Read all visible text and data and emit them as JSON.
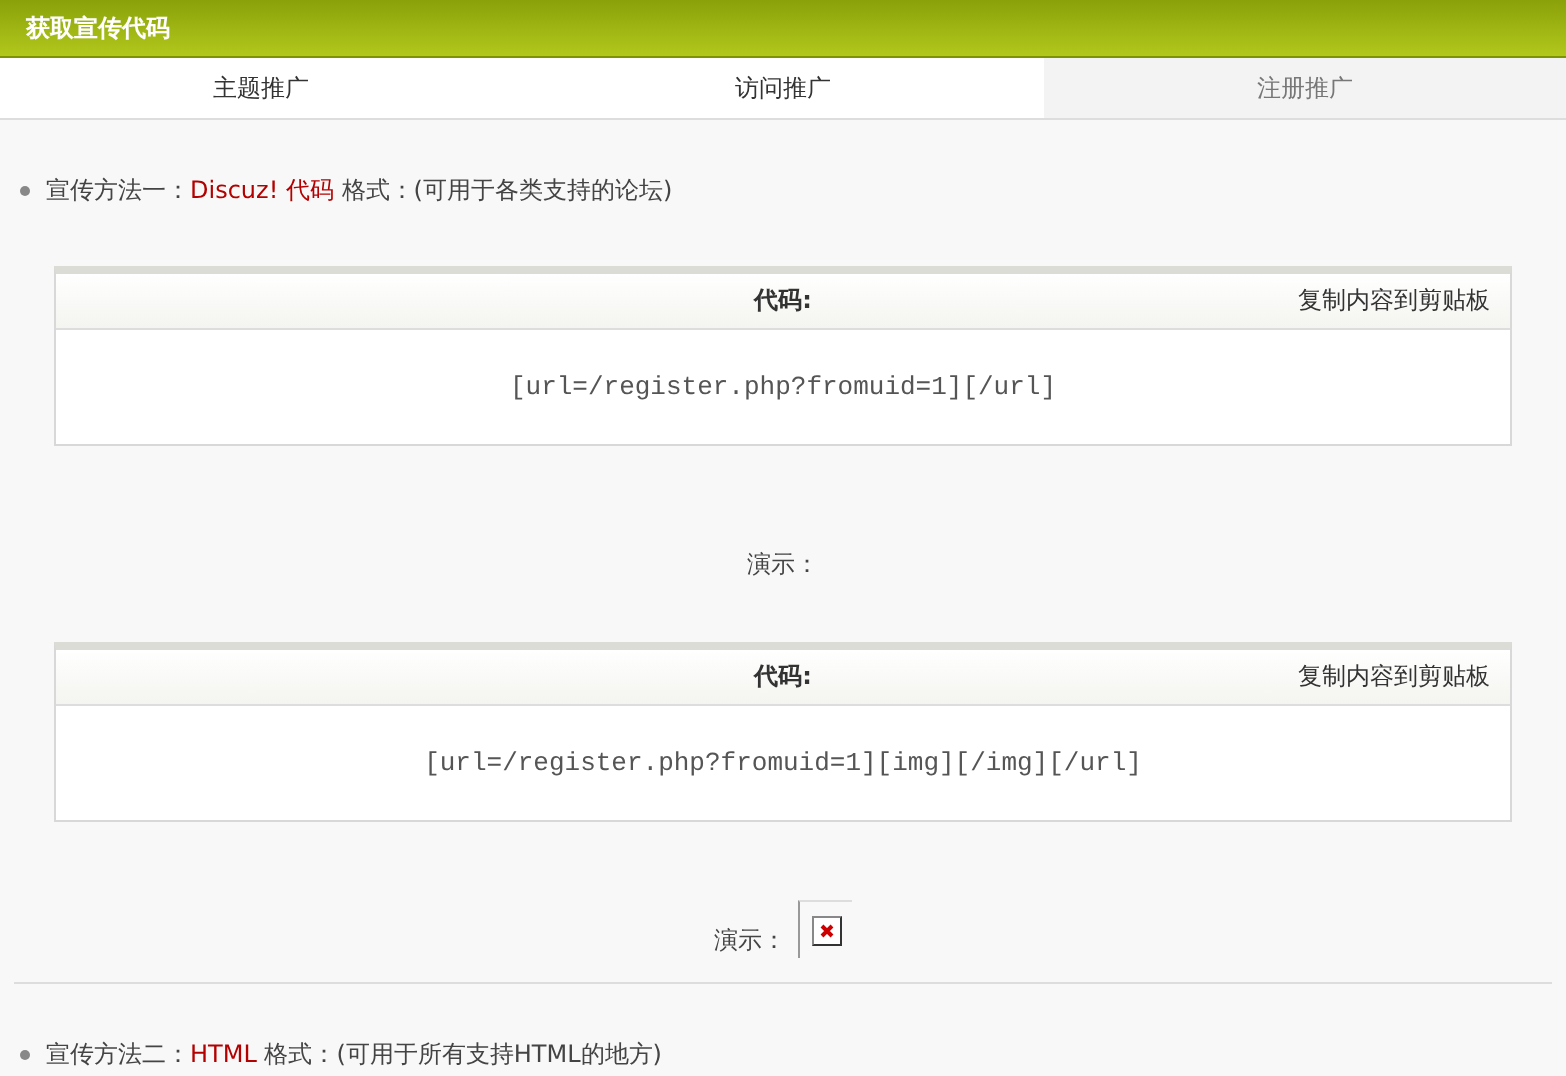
{
  "header": {
    "title": "获取宣传代码"
  },
  "tabs": [
    {
      "label": "主题推广",
      "selected": false
    },
    {
      "label": "访问推广",
      "selected": false
    },
    {
      "label": "注册推广",
      "selected": true
    }
  ],
  "methods": [
    {
      "prefix": "宣传方法一：",
      "highlight": "Discuz! 代码",
      "suffix": "格式：(可用于各类支持的论坛)",
      "blocks": [
        {
          "heading": "代码:",
          "copy": "复制内容到剪贴板",
          "code": "[url=/register.php?fromuid=1][/url]",
          "demo_label": "演示：",
          "broken_image": false
        },
        {
          "heading": "代码:",
          "copy": "复制内容到剪贴板",
          "code": "[url=/register.php?fromuid=1][img][/img][/url]",
          "demo_label": "演示：",
          "broken_image": true
        }
      ]
    },
    {
      "prefix": "宣传方法二：",
      "highlight": "HTML",
      "suffix": "格式：(可用于所有支持HTML的地方)"
    }
  ]
}
